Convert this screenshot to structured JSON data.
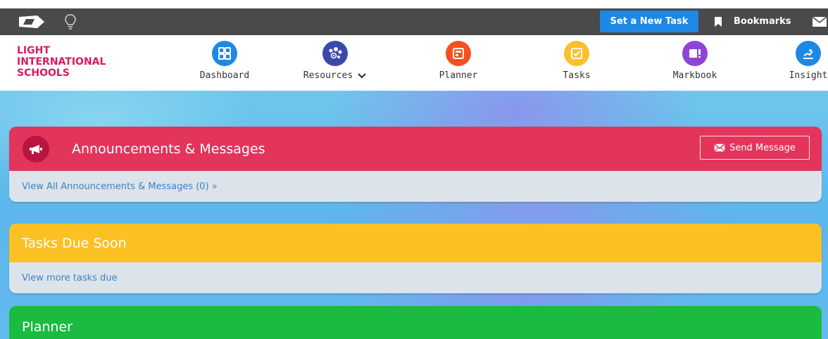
{
  "topbar": {
    "new_task_label": "Set a New Task",
    "bookmarks_label": "Bookmarks",
    "bg_color": "#4a4a4a",
    "button_color": "#1e88e5"
  },
  "school": {
    "line1": "LIGHT",
    "line2": "INTERNATIONAL",
    "line3": "SCHOOLS",
    "color": "#d81b60"
  },
  "nav": {
    "items": [
      {
        "label": "Dashboard",
        "icon": "grid-icon",
        "color": "#1e88e5"
      },
      {
        "label": "Resources",
        "icon": "resources-icon",
        "color": "#3949ab"
      },
      {
        "label": "Planner",
        "icon": "planner-icon",
        "color": "#f4511e"
      },
      {
        "label": "Tasks",
        "icon": "check-icon",
        "color": "#fbc02d"
      },
      {
        "label": "Markbook",
        "icon": "markbook-icon",
        "color": "#8e44d8"
      },
      {
        "label": "Insight",
        "icon": "insight-icon",
        "color": "#1e88e5"
      }
    ]
  },
  "announcements": {
    "title": "Announcements & Messages",
    "send_label": "Send Message",
    "view_all_label": "View All Announcements & Messages (0) »",
    "color": "#e3345c"
  },
  "tasks_due": {
    "title": "Tasks Due Soon",
    "view_more_label": "View more tasks due",
    "color": "#fbc123"
  },
  "planner_card": {
    "title": "Planner",
    "color": "#1bbb42"
  }
}
